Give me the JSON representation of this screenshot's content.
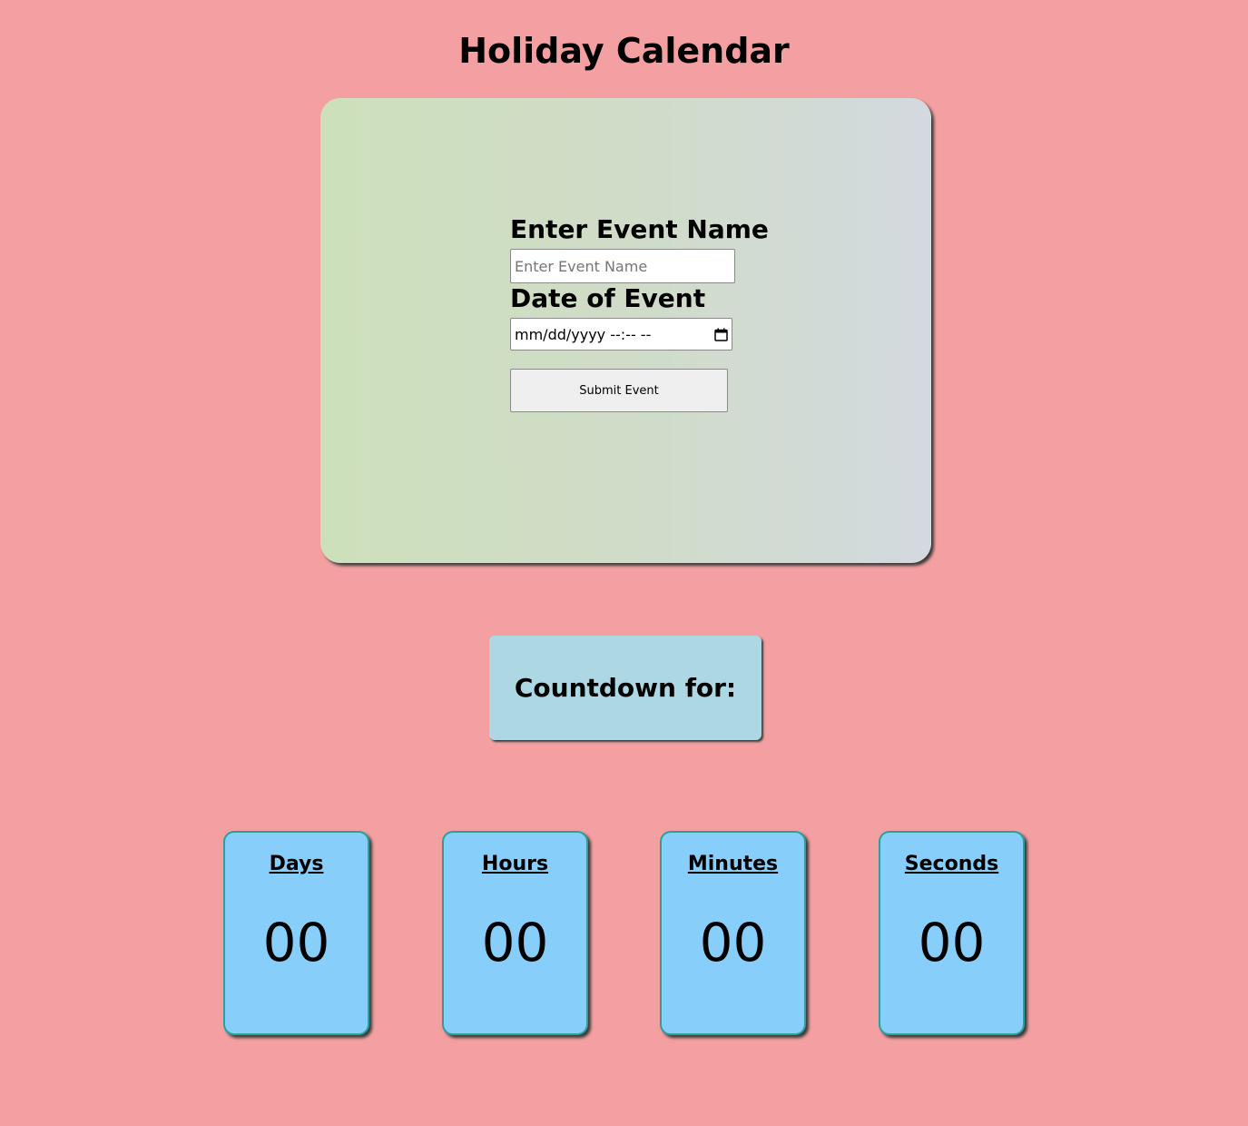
{
  "page": {
    "title": "Holiday Calendar"
  },
  "form": {
    "event_name_label": "Enter Event Name",
    "event_name_placeholder": "Enter Event Name",
    "event_name_value": "",
    "date_label": "Date of Event",
    "date_placeholder": "mm/dd/yyyy --:-- --",
    "submit_label": "Submit Event"
  },
  "countdown": {
    "label": "Countdown for:"
  },
  "timers": [
    {
      "label": "Days",
      "value": "00"
    },
    {
      "label": "Hours",
      "value": "00"
    },
    {
      "label": "Minutes",
      "value": "00"
    },
    {
      "label": "Seconds",
      "value": "00"
    }
  ],
  "colors": {
    "background": "#f4a0a2",
    "countdown_box": "#add8e3",
    "timer_card": "#87cefa",
    "timer_border": "#2aa198"
  },
  "icons": {
    "date_picker": "calendar-icon"
  }
}
